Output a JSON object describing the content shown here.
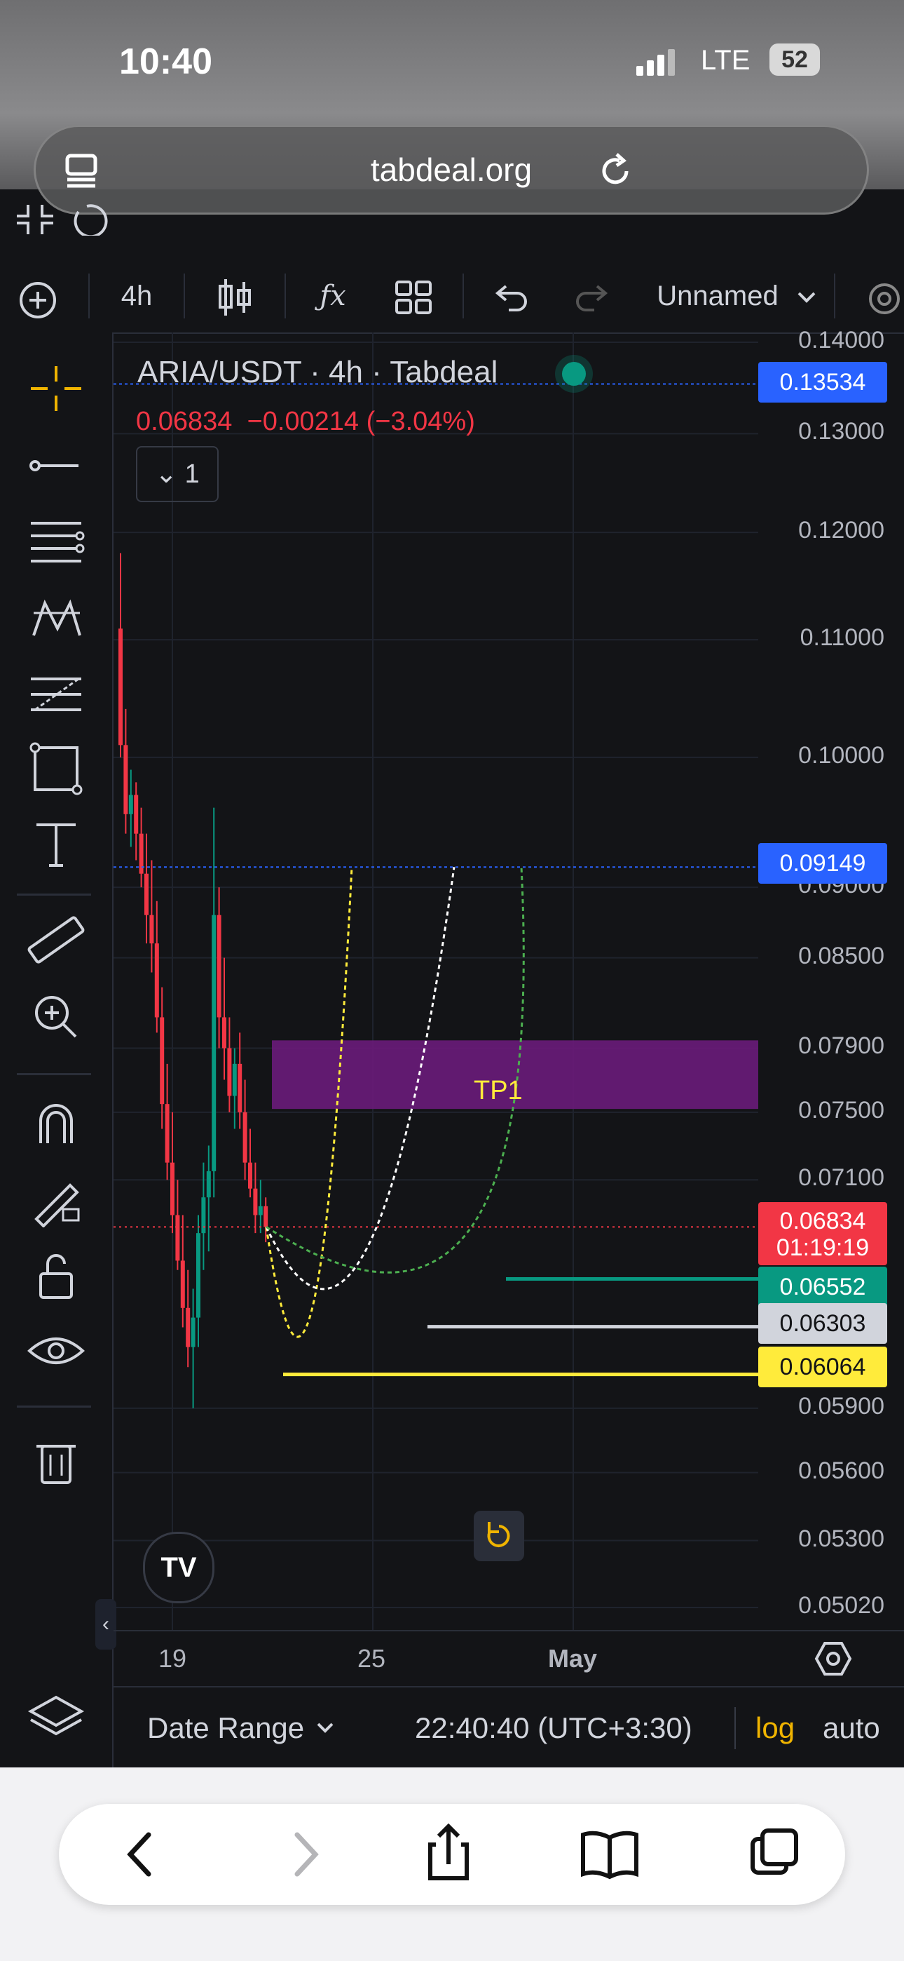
{
  "status": {
    "time": "10:40",
    "carrier": "LTE",
    "battery": "52"
  },
  "browser": {
    "url": "tabdeal.org"
  },
  "toolbar": {
    "interval": "4h",
    "layout_name": "Unnamed"
  },
  "legend": {
    "symbol": "ARIA/USDT · 4h · Tabdeal",
    "price": "0.06834",
    "change": "−0.00214 (−3.04%)",
    "collapse_count": "1"
  },
  "price_axis": {
    "ticks": [
      "0.14000",
      "0.13000",
      "0.12000",
      "0.11000",
      "0.10000",
      "0.09000",
      "0.08500",
      "0.07900",
      "0.07500",
      "0.07100",
      "0.05900",
      "0.05600",
      "0.05300",
      "0.05020"
    ],
    "labels": {
      "upper_line": "0.13534",
      "target_line": "0.09149",
      "last_price": "0.06834",
      "countdown": "01:19:19",
      "green_line": "0.06552",
      "white_line": "0.06303",
      "yellow_line": "0.06064"
    }
  },
  "zone": {
    "label": "TP1"
  },
  "date_axis": {
    "labels": [
      "19",
      "25",
      "May"
    ]
  },
  "bottom_bar": {
    "date_range": "Date Range",
    "clock": "22:40:40 (UTC+3:30)",
    "log": "log",
    "auto": "auto"
  },
  "colors": {
    "up": "#089981",
    "down": "#f23645",
    "blue": "#2962ff",
    "yellow": "#ffeb3b",
    "zone": "#6a1b7a"
  }
}
